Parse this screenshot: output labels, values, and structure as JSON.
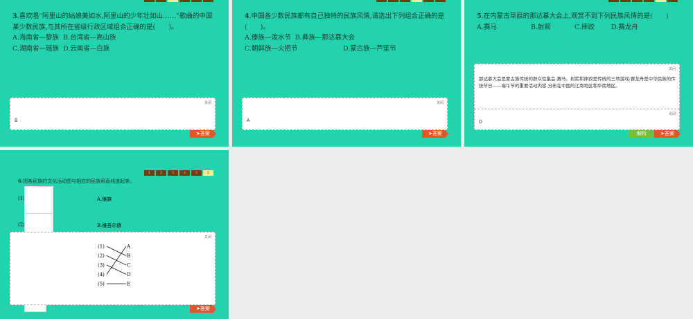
{
  "nav": [
    "1",
    "2",
    "3",
    "4",
    "5",
    "6"
  ],
  "close_label": "关闭",
  "answer_label": "➤答案",
  "analysis_label": "解析",
  "slides": [
    {
      "num": "3",
      "question": ".喜欢唱“阿里山的姑娘美如水,阿里山的少年壮如山……”歌曲的中国某少数民族,与其所在省级行政区域组合正确的是(　　)。",
      "options": [
        "A.海南省—黎族",
        "B.台湾省—高山族",
        "C.湖南省—瑶族",
        "D.云南省—白族"
      ],
      "answer": "B"
    },
    {
      "num": "4",
      "question": ".中国各少数民族都有自己独特的民族风情,请选出下列组合正确的是(　　)。",
      "options": [
        "A.傣族—泼水节",
        "B.彝族—那达慕大会",
        "C.朝鲜族—火把节",
        "D.蒙古族—芦笙节"
      ],
      "answer": "A"
    },
    {
      "num": "5",
      "question": ".在内蒙古草原的那达慕大会上,观赏不到下列民族风情的是(　　)",
      "options": [
        "A.赛马",
        "B.射箭",
        "C.摔跤",
        "D.赛龙舟"
      ],
      "answer": "D",
      "analysis": "那达慕大会是蒙古族传统的群众性集会.赛马、射箭和摔跤是传统的三项游戏;赛龙舟是中华民族的传统节日——端午节的重要活动内容,分布在中国的江南地区和华南地区。"
    },
    {
      "num": "6",
      "question": ".把各民族的文化活动图与相应的民族用直线连起来。",
      "items": [
        "(1)",
        "(2)"
      ],
      "options": [
        "A.傣族",
        "B.维吾尔族"
      ],
      "match_left": [
        "(1)",
        "(2)",
        "(3)",
        "(4)",
        "(5)"
      ],
      "match_right": [
        "A",
        "B",
        "C",
        "D",
        "E"
      ],
      "matches": [
        [
          "(1)",
          "B"
        ],
        [
          "(2)",
          "C"
        ],
        [
          "(3)",
          "D"
        ],
        [
          "(4)",
          "A"
        ],
        [
          "(5)",
          "E"
        ]
      ]
    }
  ]
}
